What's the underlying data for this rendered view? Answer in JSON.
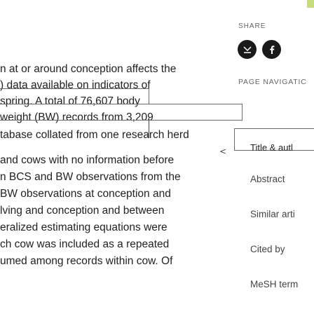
{
  "abstract": {
    "lines": [
      "n at or around conception affects the",
      ") data available on indicators of",
      "spring. A total of 76,607 body",
      "weight (BW) records from 3,209",
      "tabase collated from one research herd",
      "and cows with no information before",
      "n BCS and BW observations from the",
      "BW observations at conception and",
      "lving and conception and between",
      "eralized estimating equations were",
      "ch cow was included as a repeated",
      "umed among records within cow. Of"
    ]
  },
  "sidebar": {
    "share_label": "SHARE",
    "share_buttons": [
      {
        "name": "email-share-icon",
        "color": "#1a1a1a"
      },
      {
        "name": "facebook-share-icon",
        "color": "#1a1a1a"
      }
    ],
    "page_nav_label": "PAGE NAVIGATIC",
    "nav_items": [
      {
        "label": "Title & autl",
        "current": true
      },
      {
        "label": "Abstract"
      },
      {
        "label": "Similar arti"
      },
      {
        "label": "Cited by"
      },
      {
        "label": "MeSH term"
      }
    ]
  },
  "colors": {
    "accent_bar": "#c6dc7c",
    "text": "#222222"
  }
}
